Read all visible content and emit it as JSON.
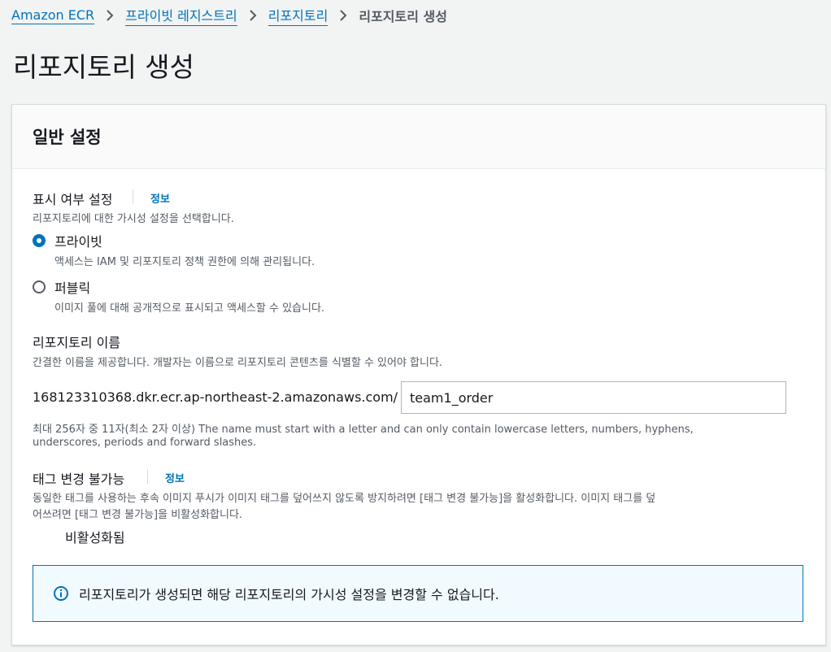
{
  "breadcrumb": {
    "items": [
      "Amazon ECR",
      "프라이빗 레지스트리",
      "리포지토리"
    ],
    "current": "리포지토리 생성"
  },
  "page_title": "리포지토리 생성",
  "general_settings": {
    "title": "일반 설정",
    "visibility": {
      "label": "표시 여부 설정",
      "info": "정보",
      "description": "리포지토리에 대한 가시성 설정을 선택합니다.",
      "options": [
        {
          "label": "프라이빗",
          "description": "액세스는 IAM 및 리포지토리 정책 권한에 의해 관리됩니다.",
          "selected": true
        },
        {
          "label": "퍼블릭",
          "description": "이미지 풀에 대해 공개적으로 표시되고 액세스할 수 있습니다.",
          "selected": false
        }
      ]
    },
    "repo_name": {
      "label": "리포지토리 이름",
      "description": "간결한 이름을 제공합니다. 개발자는 이름으로 리포지토리 콘텐츠를 식별할 수 있어야 합니다.",
      "prefix": "168123310368.dkr.ecr.ap-northeast-2.amazonaws.com/",
      "value": "team1_order",
      "constraint_line1": "최대 256자 중 11자(최소 2자 이상) The name must start with a letter and can only contain lowercase letters, numbers, hyphens,",
      "constraint_line2": "underscores, periods and forward slashes."
    },
    "tag_immutability": {
      "label": "태그 변경 불가능",
      "info": "정보",
      "description_line1": "동일한 태그를 사용하는 후속 이미지 푸시가 이미지 태그를 덮어쓰지 않도록 방지하려면 [태그 변경 불가능]을 활성화합니다. 이미지 태그를 덮",
      "description_line2": "어쓰려면 [태그 변경 불가능]을 비활성화합니다.",
      "toggle_label": "비활성화됨",
      "enabled": false
    },
    "alert": {
      "text": "리포지토리가 생성되면 해당 리포지토리의 가시성 설정을 변경할 수 없습니다."
    }
  },
  "colors": {
    "link": "#0073bb",
    "background": "#f2f3f3",
    "panel_header": "#fafafa",
    "alert_bg": "#f1faff",
    "toggle_off": "#545b64"
  }
}
